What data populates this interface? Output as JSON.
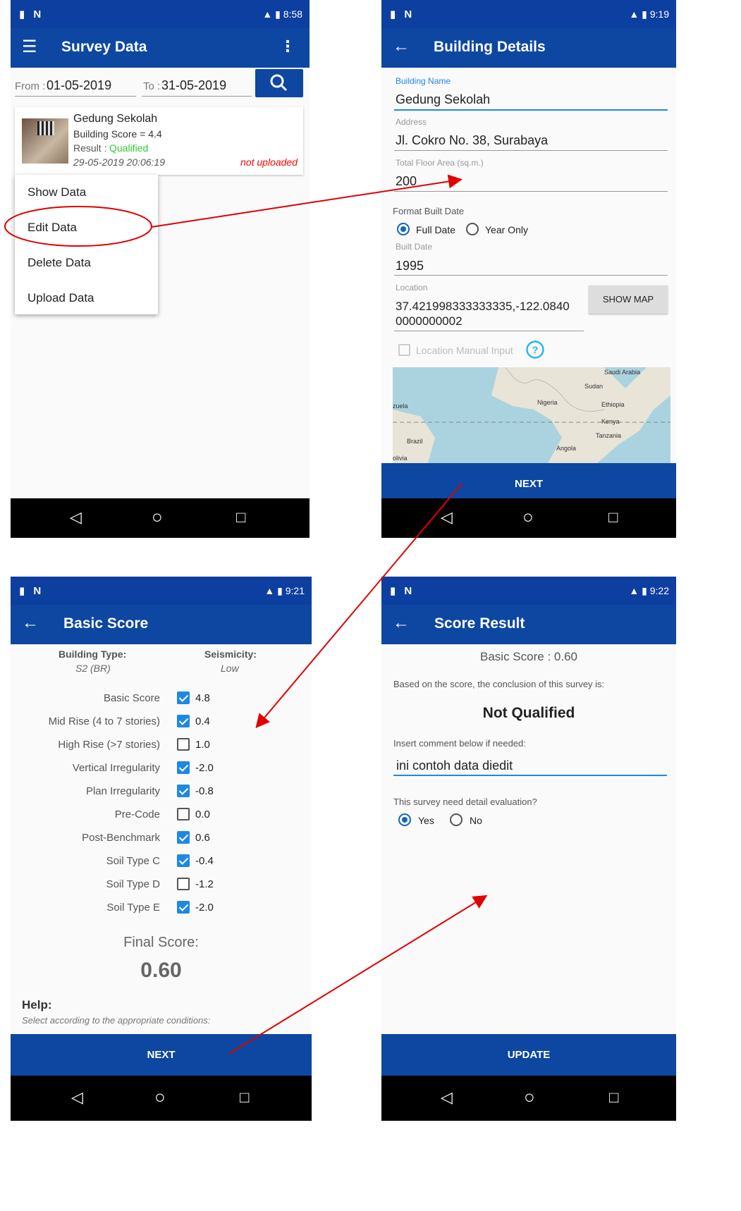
{
  "screen1": {
    "status_time": "8:58",
    "title": "Survey Data",
    "from_label": "From :",
    "from_value": "01-05-2019",
    "to_label": "To :",
    "to_value": "31-05-2019",
    "card": {
      "name": "Gedung Sekolah",
      "score": "Building Score = 4.4",
      "result_label": "Result :",
      "result_value": "Qualified",
      "date": "29-05-2019 20:06:19",
      "upload_status": "not uploaded"
    },
    "menu": [
      "Show Data",
      "Edit Data",
      "Delete Data",
      "Upload Data"
    ]
  },
  "screen2": {
    "status_time": "9:19",
    "title": "Building Details",
    "building_name_label": "Building Name",
    "building_name": "Gedung Sekolah",
    "address_label": "Address",
    "address": "Jl. Cokro No. 38, Surabaya",
    "floor_area_label": "Total Floor Area (sq.m.)",
    "floor_area": "200",
    "format_label": "Format Built Date",
    "opt_full": "Full Date",
    "opt_year": "Year Only",
    "built_label": "Built Date",
    "built_value": "1995",
    "location_label": "Location",
    "location_line1": "37.421998333333335,-122.0840",
    "location_line2": "0000000002",
    "show_map": "SHOW MAP",
    "manual_label": "Location Manual Input",
    "map_labels": [
      "Saudi Arabia",
      "Sudan",
      "Nigeria",
      "Ethiopia",
      "zuela",
      "Kenya",
      "Tanzania",
      "Brazil",
      "Angola",
      "olivia"
    ],
    "next": "NEXT"
  },
  "screen3": {
    "status_time": "9:21",
    "title": "Basic Score",
    "building_type_label": "Building Type:",
    "building_type": "S2 (BR)",
    "seismicity_label": "Seismicity:",
    "seismicity": "Low",
    "rows": [
      {
        "label": "Basic Score",
        "checked": true,
        "value": "4.8"
      },
      {
        "label": "Mid Rise (4 to 7 stories)",
        "checked": true,
        "value": "0.4"
      },
      {
        "label": "High Rise (>7 stories)",
        "checked": false,
        "value": "1.0"
      },
      {
        "label": "Vertical Irregularity",
        "checked": true,
        "value": "-2.0"
      },
      {
        "label": "Plan Irregularity",
        "checked": true,
        "value": "-0.8"
      },
      {
        "label": "Pre-Code",
        "checked": false,
        "value": "0.0"
      },
      {
        "label": "Post-Benchmark",
        "checked": true,
        "value": "0.6"
      },
      {
        "label": "Soil Type C",
        "checked": true,
        "value": "-0.4"
      },
      {
        "label": "Soil Type D",
        "checked": false,
        "value": "-1.2"
      },
      {
        "label": "Soil Type E",
        "checked": true,
        "value": "-2.0"
      }
    ],
    "final_label": "Final Score:",
    "final_value": "0.60",
    "help_title": "Help:",
    "help_text": "Select according to the appropriate conditions:",
    "next": "NEXT"
  },
  "screen4": {
    "status_time": "9:22",
    "title": "Score Result",
    "basic_score": "Basic Score : 0.60",
    "conclusion_text": "Based on the score, the conclusion of this survey is:",
    "conclusion": "Not Qualified",
    "comment_label": "Insert comment below if needed:",
    "comment_value": "ini contoh data diedit",
    "detail_question": "This survey need detail evaluation?",
    "opt_yes": "Yes",
    "opt_no": "No",
    "update": "UPDATE"
  },
  "nav_icons": {
    "back": "◁",
    "home": "○",
    "recent": "□"
  },
  "colors": {
    "primary": "#0d47a1",
    "accent": "#1e88e5",
    "qualified": "#2ecc2e",
    "not_uploaded": "#ff0000",
    "annotation": "#e00000"
  }
}
